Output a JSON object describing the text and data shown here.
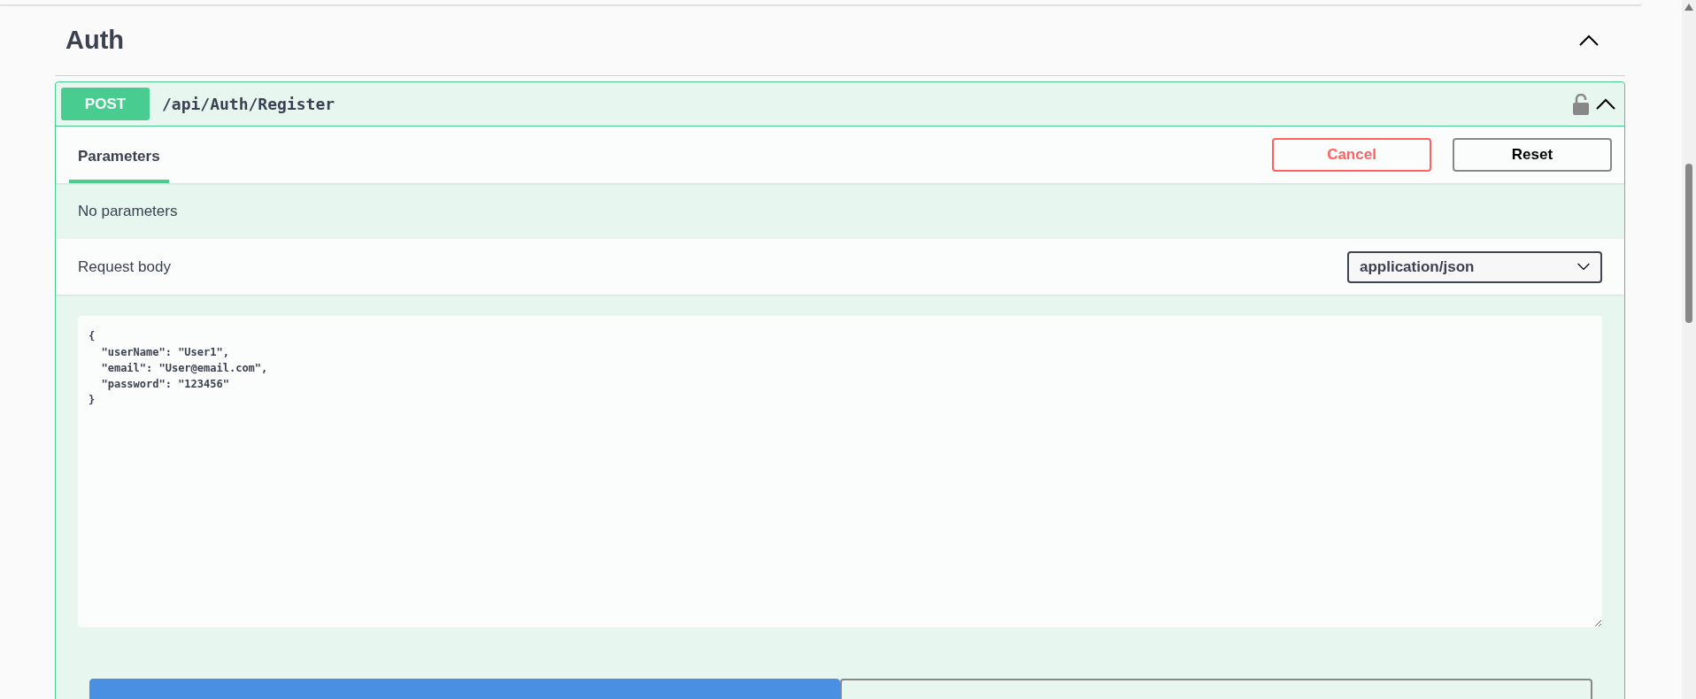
{
  "section": {
    "title": "Auth",
    "expanded": true
  },
  "operation": {
    "method": "POST",
    "path": "/api/Auth/Register",
    "expanded": true,
    "tabs": [
      {
        "label": "Parameters",
        "selected": true
      }
    ],
    "actions": [
      {
        "label": "Cancel",
        "kind": "cancel"
      },
      {
        "label": "Reset",
        "kind": "reset"
      }
    ],
    "parameters_message": "No parameters",
    "request_body": {
      "label": "Request body",
      "content_type": "application/json",
      "value": "{\n  \"userName\": \"User1\",\n  \"email\": \"User@email.com\",\n  \"password\": \"123456\"\n}"
    },
    "bottom_buttons": [
      {
        "kind": "primary"
      },
      {
        "kind": "outline"
      }
    ]
  }
}
